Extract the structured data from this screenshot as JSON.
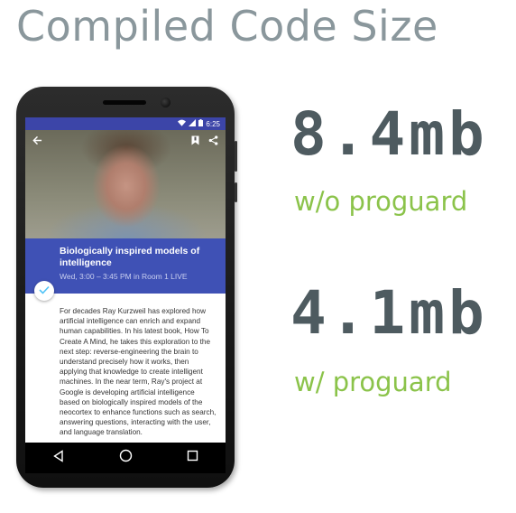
{
  "slide": {
    "title": "Compiled Code Size"
  },
  "phone": {
    "status_time": "6:25",
    "talk": {
      "title": "Biologically inspired models of intelligence",
      "meta": "Wed, 3:00 – 3:45 PM in Room 1 LIVE",
      "body": "For decades Ray Kurzweil has explored how artificial intelligence can enrich and expand human capabilities. In his latest book, How To Create A Mind, he takes this exploration to the next step: reverse-engineering the brain to understand precisely how it works, then applying that knowledge to create intelligent machines. In the near term, Ray's project at Google is developing artificial intelligence based on biologically inspired models of the neocortex to enhance functions such as search, answering questions, interacting with the user, and language translation."
    },
    "icons": {
      "back": "arrow-back-icon",
      "bookmark": "bookmark-icon",
      "share": "share-icon",
      "check": "check-icon",
      "nav_back": "nav-back-icon",
      "nav_home": "nav-home-icon",
      "nav_recents": "nav-recents-icon"
    },
    "colors": {
      "app_bar": "#3f51b5",
      "status_bar": "#3c45a8",
      "accent_check": "#4fc3f7"
    }
  },
  "stats": [
    {
      "value": "8.4mb",
      "caption": "w/o proguard"
    },
    {
      "value": "4.1mb",
      "caption": "w/ proguard"
    }
  ],
  "colors": {
    "title": "#8a979c",
    "value": "#4e5b60",
    "caption": "#8bc34a"
  }
}
